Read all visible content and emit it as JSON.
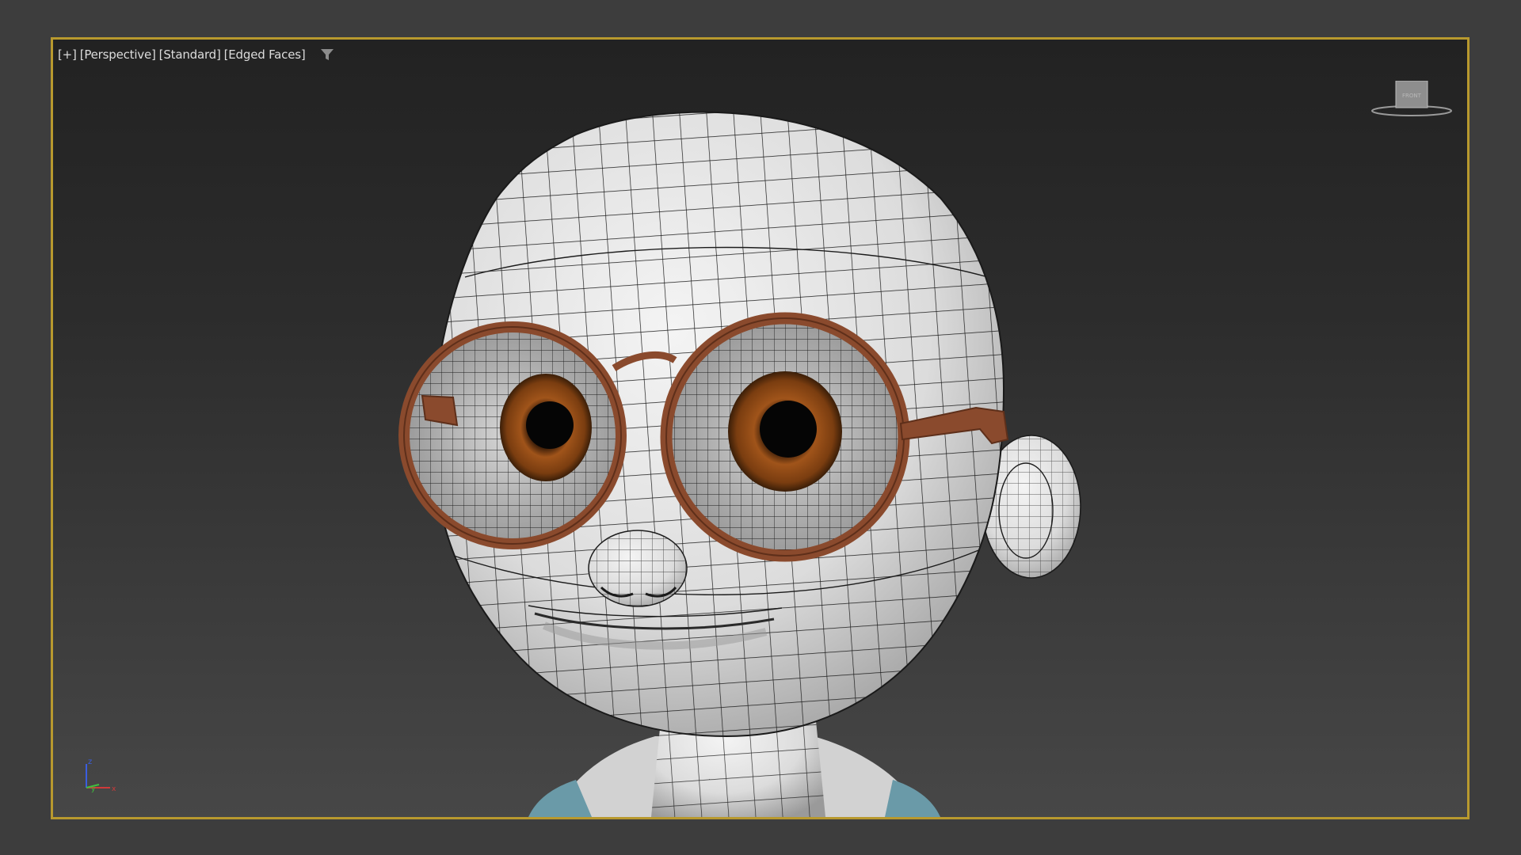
{
  "viewport": {
    "label_plus": "[+]",
    "label_view": "[Perspective]",
    "label_shading": "[Standard]",
    "label_edges": "[Edged Faces]",
    "filter_icon": "filter-icon",
    "border_color": "#b8992e"
  },
  "viewcube": {
    "face_label": "FRONT",
    "icon": "viewcube-icon"
  },
  "axis": {
    "z": "z",
    "y": "y",
    "x": "x",
    "colors": {
      "x": "#d03a3a",
      "y": "#3fbf3f",
      "z": "#3a5ee0"
    }
  },
  "model": {
    "skin_color": "#e4e4e4",
    "glasses_color": "#8a4a2d",
    "iris_color": "#8a4a16",
    "shirt_color": "#6a9aa8"
  }
}
